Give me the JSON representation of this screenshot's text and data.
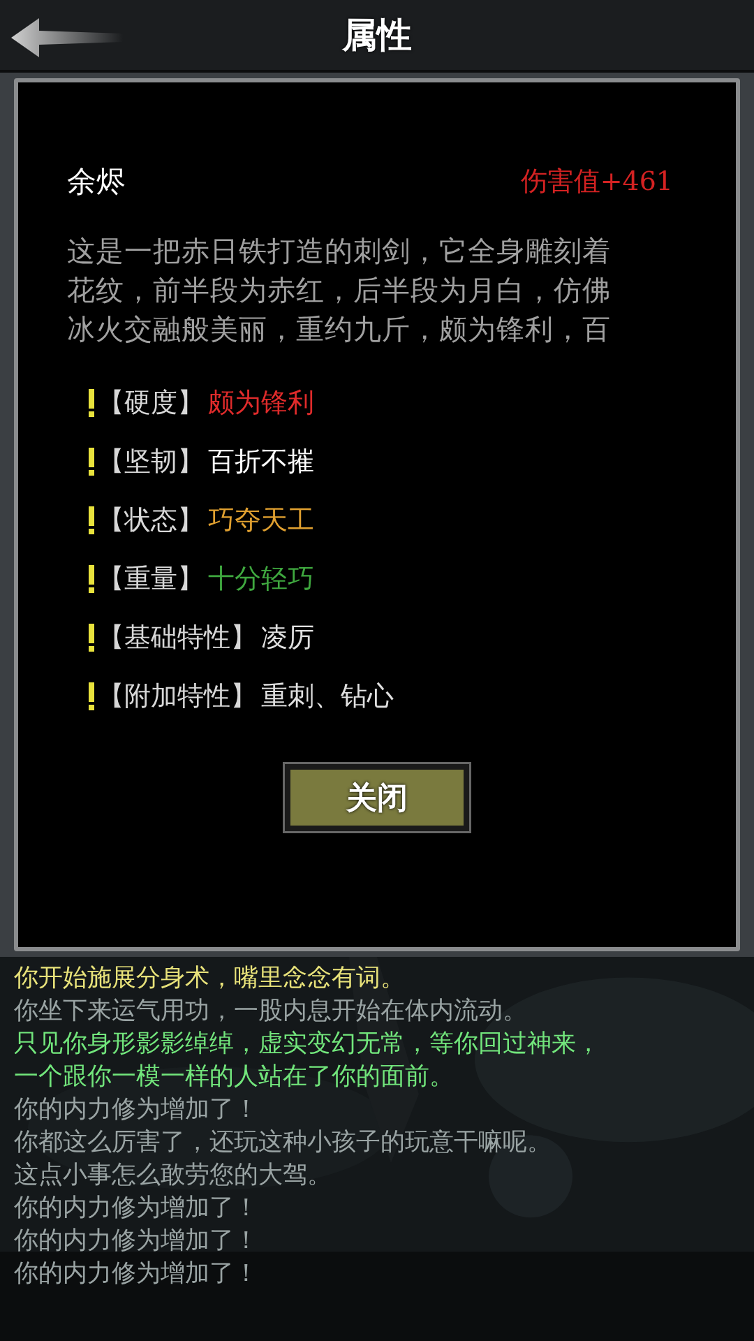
{
  "header": {
    "title": "属性"
  },
  "item": {
    "name": "余烬",
    "damage": "伤害值+461",
    "description": [
      "这是一把赤日铁打造的刺剑，它全身雕刻着",
      "花纹，前半段为赤红，后半段为月白，仿佛",
      "冰火交融般美丽，重约九斤，颇为锋利，百"
    ],
    "attributes": [
      {
        "label": "【硬度】",
        "value": "颇为锋利",
        "color": "#e02b2b"
      },
      {
        "label": "【坚韧】",
        "value": "百折不摧",
        "color": "#ffffff"
      },
      {
        "label": "【状态】",
        "value": "巧夺天工",
        "color": "#e0a030"
      },
      {
        "label": "【重量】",
        "value": "十分轻巧",
        "color": "#3fa83f"
      },
      {
        "label": "【基础特性】",
        "value": "凌厉",
        "color": "#e0e0e0"
      },
      {
        "label": "【附加特性】",
        "value": "重刺、钻心",
        "color": "#e0e0e0"
      }
    ],
    "close_button": "关闭"
  },
  "log": [
    {
      "text": "你开始施展分身术，嘴里念念有词。",
      "color": "#e8e27a"
    },
    {
      "text": "你坐下来运气用功，一股内息开始在体内流动。",
      "color": "#9aa4a4"
    },
    {
      "text": "只见你身形影影绰绰，虚实变幻无常，等你回过神来，",
      "color": "#72e67c"
    },
    {
      "text": "一个跟你一模一样的人站在了你的面前。",
      "color": "#72e67c"
    },
    {
      "text": "你的内力修为增加了！",
      "color": "#9aa4a4"
    },
    {
      "text": "你都这么厉害了，还玩这种小孩子的玩意干嘛呢。",
      "color": "#9aa4a4"
    },
    {
      "text": "这点小事怎么敢劳您的大驾。",
      "color": "#9aa4a4"
    },
    {
      "text": "你的内力修为增加了！",
      "color": "#9aa4a4"
    },
    {
      "text": "你的内力修为增加了！",
      "color": "#9aa4a4"
    },
    {
      "text": "你的内力修为增加了！",
      "color": "#9aa4a4"
    }
  ]
}
